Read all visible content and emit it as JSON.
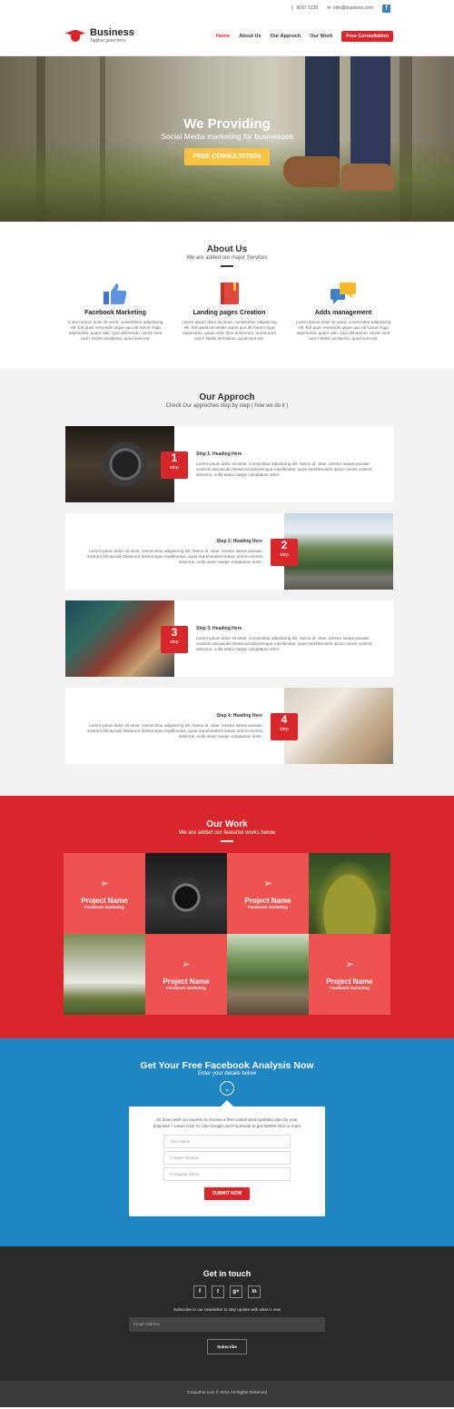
{
  "topbar": {
    "phone": "6037 3128",
    "email": "info@business.com",
    "fb_icon": "f"
  },
  "header": {
    "brand": "Business",
    "tagline": "Tagline goes here",
    "nav": [
      "Home",
      "About Us",
      "Our Approch",
      "Our Work"
    ],
    "cta": "Free Consultation",
    "accent": "#d9262a"
  },
  "hero": {
    "title": "We Providing",
    "subtitle": "Social Media marketing for businesses",
    "button": "FREE CONSULTATION",
    "button_color": "#f6c342"
  },
  "about": {
    "title": "About Us",
    "subtitle": "We are added our major Services",
    "services": [
      {
        "icon": "thumbs-up-icon",
        "title": "Facebook Marketing",
        "text": "Lorem ipsum dolor sit amet, consectetur adipisicing elit. Est quas reiciendis atque quo ab harum fuga asperiores, quam velit. Quo doloremm, omnis sunt cum? Nobis architecto, quod sunt est."
      },
      {
        "icon": "book-icon",
        "title": "Landing pages Creation",
        "text": "Lorem ipsum dolor sit amet, consectetur adipisicing elit. Est quas reiciendis atque quo ab harum fuga asperiores, quam velit. Quo doloremm, omnis sunt cum? Nobis architecto, quod sunt est."
      },
      {
        "icon": "chat-bubbles-icon",
        "title": "Adds management",
        "text": "Lorem ipsum dolor sit amet, consectetur adipisicing elit. Est quas reiciendis atque quo ab harum fuga asperiores, quam velit. Quo doloremm, omnis sunt cum? Nobis architecto, quod sunt est."
      }
    ]
  },
  "approach": {
    "title": "Our Approch",
    "subtitle": "Check Our approches step by step ( how we do it )",
    "step_word": "step",
    "steps": [
      {
        "num": "1",
        "heading": "Step 1: Heading Here",
        "text": "Lorem ipsum dolor sit amet, consectetur adipisicing elit. Nemo id, vitae, tenetur saepe pariatur nostrum obcaecati! Deserunt doloremque repellendus, quas reprehenderit ipsum omnis minima delectus, nulla totam saepe voluptatum dolor."
      },
      {
        "num": "2",
        "heading": "Step 2: Heading Here",
        "text": "Lorem ipsum dolor sit amet, consectetur adipisicing elit. Nemo id, vitae, tenetur saepe pariatur nostrum obcaecati! Deserunt doloremque repellendus, quas reprehenderit ipsum omnis minima delectus, nulla totam saepe voluptatum dolor."
      },
      {
        "num": "3",
        "heading": "Step 3: Heading Here",
        "text": "Lorem ipsum dolor sit amet, consectetur adipisicing elit. Nemo id, vitae, tenetur saepe pariatur nostrum obcaecati! Deserunt doloremque repellendus, quas reprehenderit ipsum omnis minima delectus, nulla totam saepe voluptatum dolor."
      },
      {
        "num": "4",
        "heading": "Step 4: Heading Here",
        "text": "Lorem ipsum dolor sit amet, consectetur adipisicing elit. Nemo id, vitae, tenetur saepe pariatur nostrum obcaecati! Deserunt doloremque repellendus, quas reprehenderit ipsum omnis minima delectus, nulla totam saepe voluptatum dolor."
      }
    ]
  },
  "work": {
    "title": "Our Work",
    "subtitle": "We are added our featured works below",
    "project_name": "Project Name",
    "project_category": "Facebook marketing"
  },
  "analysis": {
    "title": "Get Your Free Facebook Analysis Now",
    "subtitle": "Enter your details below",
    "intro": "Sit down with our experts to receive a free customized marketin plan for your business + Learn How To Use Google and Facebook to get 5000% ROI or more",
    "placeholders": {
      "name": "Your Name",
      "contact": "Contact Number",
      "company": "Company Name"
    },
    "submit": "SUBMIT NOW"
  },
  "contact": {
    "title": "Get in touch",
    "socials": [
      "f",
      "t",
      "g+",
      "in"
    ],
    "newsletter": "Subscribe to our newsletter to stay update with what is new",
    "email_placeholder": "Email Address",
    "subscribe": "Subscribe"
  },
  "footer": {
    "copyright": "Cssauthor.com © 2014 All Rights Reserved"
  }
}
